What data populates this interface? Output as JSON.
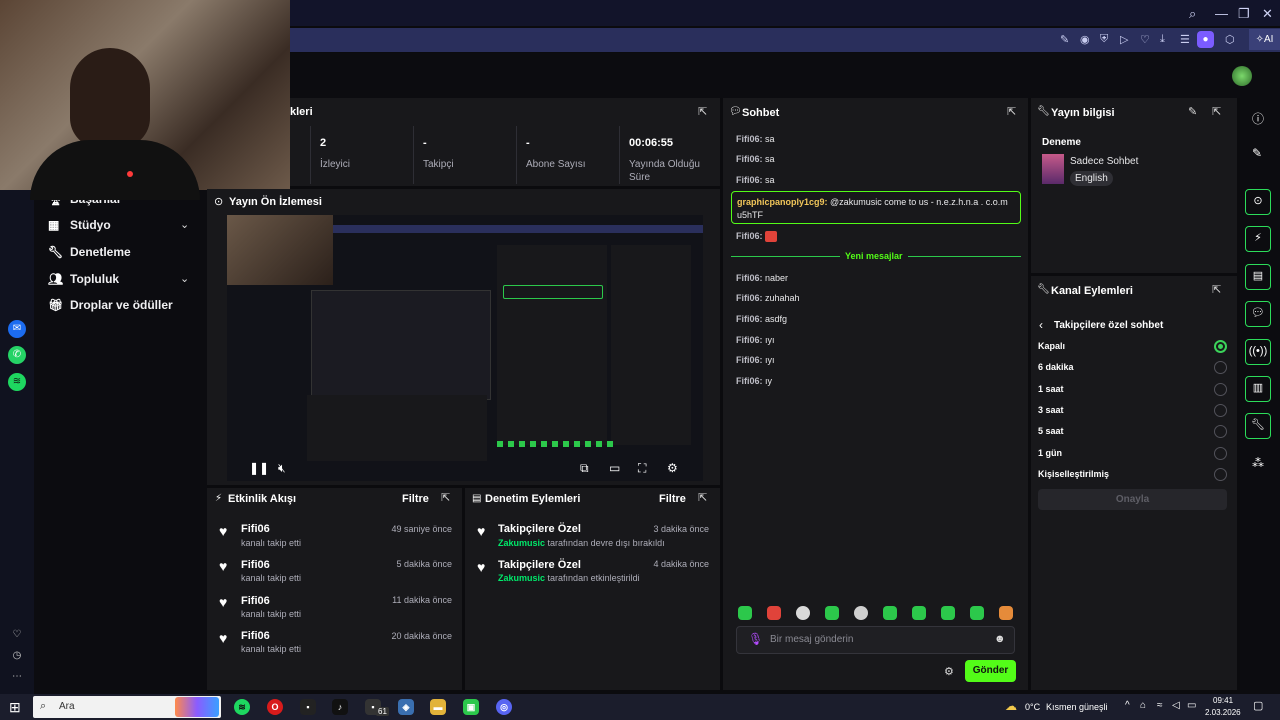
{
  "stats": {
    "title": "kleri",
    "items": [
      {
        "value": "2",
        "label": "İzleyici"
      },
      {
        "value": "-",
        "label": "Takipçi"
      },
      {
        "value": "-",
        "label": "Abone Sayısı"
      },
      {
        "value": "00:06:55",
        "label": "Yayında Olduğu Süre"
      }
    ]
  },
  "nav": {
    "items": [
      {
        "label": "Başarılar"
      },
      {
        "label": "Stüdyo"
      },
      {
        "label": "Denetleme"
      },
      {
        "label": "Topluluk"
      },
      {
        "label": "Droplar ve ödüller"
      }
    ]
  },
  "preview": {
    "title": "Yayın Ön İzlemesi"
  },
  "activity": {
    "title": "Etkinlik Akışı",
    "filter": "Filtre",
    "items": [
      {
        "name": "Fifi06",
        "sub": "kanalı takip etti",
        "time": "49 saniye önce"
      },
      {
        "name": "Fifi06",
        "sub": "kanalı takip etti",
        "time": "5 dakika önce"
      },
      {
        "name": "Fifi06",
        "sub": "kanalı takip etti",
        "time": "11 dakika önce"
      },
      {
        "name": "Fifi06",
        "sub": "kanalı takip etti",
        "time": "20 dakika önce"
      }
    ]
  },
  "moderation": {
    "title": "Denetim Eylemleri",
    "filter": "Filtre",
    "items": [
      {
        "name": "Takipçilere Özel",
        "user": "Zakumusic",
        "sub": "tarafından devre dışı bırakıldı",
        "time": "3 dakika önce"
      },
      {
        "name": "Takipçilere Özel",
        "user": "Zakumusic",
        "sub": "tarafından etkinleştirildi",
        "time": "4 dakika önce"
      }
    ]
  },
  "chat": {
    "title": "Sohbet",
    "messages": [
      {
        "user": "Fifi06:",
        "text": "sa"
      },
      {
        "user": "Fifi06:",
        "text": "sa"
      },
      {
        "user": "Fifi06:",
        "text": "sa"
      }
    ],
    "highlight": {
      "user": "graphicpanoply1cg9:",
      "text": "@zakumusic come to us - n.e.z.h.n.a . c.o.m u5hTF"
    },
    "emote_msg": {
      "user": "Fifi06:"
    },
    "new_messages": "Yeni mesajlar",
    "messages_after": [
      {
        "user": "Fifi06:",
        "text": "naber"
      },
      {
        "user": "Fifi06:",
        "text": "zuhahah"
      },
      {
        "user": "Fifi06:",
        "text": "asdfg"
      },
      {
        "user": "Fifi06:",
        "text": "ıyı"
      },
      {
        "user": "Fifi06:",
        "text": "ıyı"
      },
      {
        "user": "Fifi06:",
        "text": "ıy"
      }
    ],
    "placeholder": "Bir mesaj gönderin",
    "send": "Gönder"
  },
  "stream_info": {
    "title": "Yayın bilgisi",
    "stream_title": "Deneme",
    "category": "Sadece Sohbet",
    "tag": "English"
  },
  "channel_actions": {
    "title": "Kanal Eylemleri",
    "sub_title": "Takipçilere özel sohbet",
    "options": [
      "Kapalı",
      "6 dakika",
      "1 saat",
      "3 saat",
      "5 saat",
      "1 gün",
      "Kişiselleştirilmiş"
    ],
    "selected_index": 0,
    "confirm": "Onayla"
  },
  "taskbar": {
    "search": "Ara",
    "badge": "61",
    "weather": "0°C",
    "weather_text": "Kısmen güneşli",
    "time": "09:41",
    "date": "2.03.2026"
  },
  "colors": {
    "accent": "#53fc18",
    "panel": "#18181b",
    "bg": "#0b0b0e"
  }
}
